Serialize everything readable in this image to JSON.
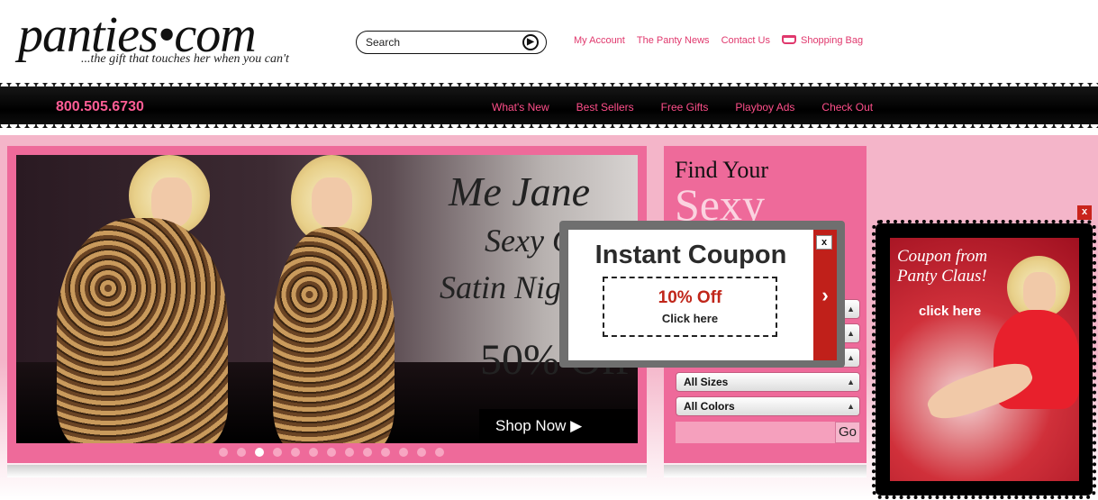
{
  "header": {
    "logo_word": "panties•com",
    "tagline": "...the gift that touches her when you can't",
    "search_placeholder": "Search",
    "top_links": [
      "My Account",
      "The Panty News",
      "Contact Us",
      "Shopping Bag"
    ]
  },
  "nav": {
    "phone": "800.505.6730",
    "links": [
      "What's New",
      "Best Sellers",
      "Free Gifts",
      "Playboy Ads",
      "Check Out"
    ]
  },
  "hero": {
    "headline_1": "Me Jane",
    "headline_2": "Sexy C",
    "headline_3": "Satin Nigh",
    "discount": "50% Off",
    "shop_now": "Shop Now ▶",
    "slide_count": 13,
    "active_slide": 3
  },
  "finder": {
    "title": "Find Your",
    "highlight": "Sexy",
    "note": "d.",
    "selects": [
      "",
      "",
      "",
      "All Sizes",
      "All Colors"
    ],
    "go": "Go"
  },
  "coupon": {
    "title": "Instant Coupon",
    "offer": "10% Off",
    "cta": "Click here",
    "close": "x",
    "next": "›"
  },
  "side_ad": {
    "close": "x",
    "text_1": "Coupon from",
    "text_2": "Panty Claus!",
    "cta": "click here"
  },
  "colors": {
    "accent": "#e0386d",
    "nav_link": "#ff4f8a",
    "pink_panel": "#ee6a9a",
    "coupon_red": "#c0261a"
  }
}
